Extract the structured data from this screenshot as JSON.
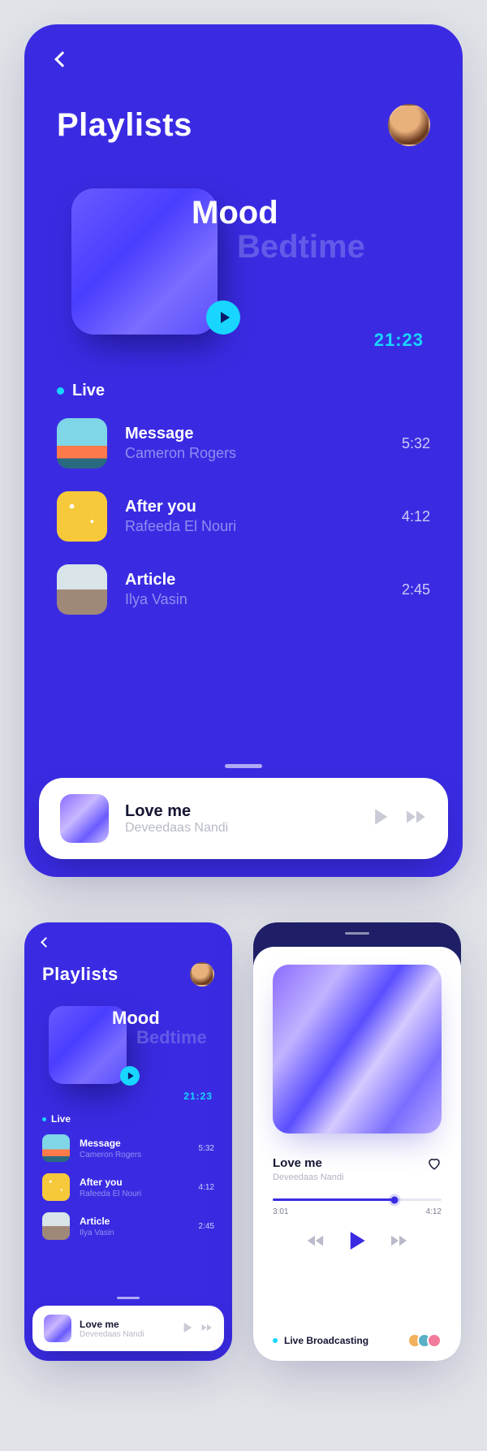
{
  "colors": {
    "accent": "#3a2be3",
    "cyan": "#18d6ff"
  },
  "screen": {
    "title": "Playlists",
    "featured": {
      "title": "Mood",
      "subtitle": "Bedtime",
      "duration": "21:23"
    },
    "section_label": "Live",
    "tracks": [
      {
        "title": "Message",
        "artist": "Cameron Rogers",
        "duration": "5:32"
      },
      {
        "title": "After you",
        "artist": "Rafeeda El Nouri",
        "duration": "4:12"
      },
      {
        "title": "Article",
        "artist": "Ilya Vasin",
        "duration": "2:45"
      }
    ],
    "nowplaying": {
      "title": "Love me",
      "artist": "Deveedaas Nandi"
    }
  },
  "player": {
    "title": "Love me",
    "artist": "Deveedaas Nandi",
    "elapsed": "3:01",
    "total": "4:12",
    "footer": "Live Broadcasting"
  }
}
